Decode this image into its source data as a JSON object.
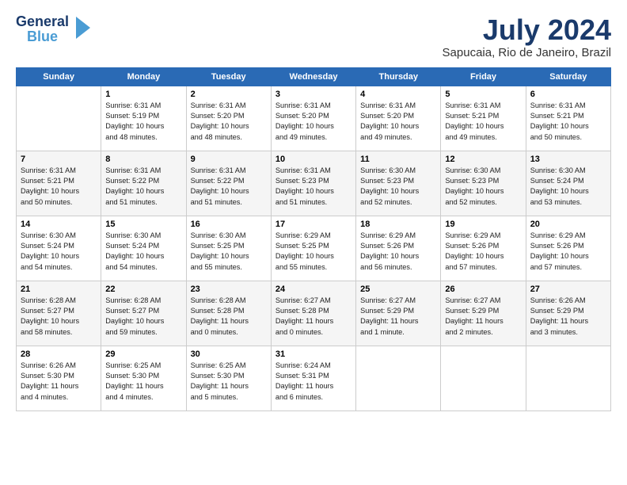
{
  "logo": {
    "line1": "General",
    "line2": "Blue",
    "icon": "▶"
  },
  "title": "July 2024",
  "subtitle": "Sapucaia, Rio de Janeiro, Brazil",
  "days_of_week": [
    "Sunday",
    "Monday",
    "Tuesday",
    "Wednesday",
    "Thursday",
    "Friday",
    "Saturday"
  ],
  "weeks": [
    [
      {
        "num": "",
        "info": ""
      },
      {
        "num": "1",
        "info": "Sunrise: 6:31 AM\nSunset: 5:19 PM\nDaylight: 10 hours\nand 48 minutes."
      },
      {
        "num": "2",
        "info": "Sunrise: 6:31 AM\nSunset: 5:20 PM\nDaylight: 10 hours\nand 48 minutes."
      },
      {
        "num": "3",
        "info": "Sunrise: 6:31 AM\nSunset: 5:20 PM\nDaylight: 10 hours\nand 49 minutes."
      },
      {
        "num": "4",
        "info": "Sunrise: 6:31 AM\nSunset: 5:20 PM\nDaylight: 10 hours\nand 49 minutes."
      },
      {
        "num": "5",
        "info": "Sunrise: 6:31 AM\nSunset: 5:21 PM\nDaylight: 10 hours\nand 49 minutes."
      },
      {
        "num": "6",
        "info": "Sunrise: 6:31 AM\nSunset: 5:21 PM\nDaylight: 10 hours\nand 50 minutes."
      }
    ],
    [
      {
        "num": "7",
        "info": "Sunrise: 6:31 AM\nSunset: 5:21 PM\nDaylight: 10 hours\nand 50 minutes."
      },
      {
        "num": "8",
        "info": "Sunrise: 6:31 AM\nSunset: 5:22 PM\nDaylight: 10 hours\nand 51 minutes."
      },
      {
        "num": "9",
        "info": "Sunrise: 6:31 AM\nSunset: 5:22 PM\nDaylight: 10 hours\nand 51 minutes."
      },
      {
        "num": "10",
        "info": "Sunrise: 6:31 AM\nSunset: 5:23 PM\nDaylight: 10 hours\nand 51 minutes."
      },
      {
        "num": "11",
        "info": "Sunrise: 6:30 AM\nSunset: 5:23 PM\nDaylight: 10 hours\nand 52 minutes."
      },
      {
        "num": "12",
        "info": "Sunrise: 6:30 AM\nSunset: 5:23 PM\nDaylight: 10 hours\nand 52 minutes."
      },
      {
        "num": "13",
        "info": "Sunrise: 6:30 AM\nSunset: 5:24 PM\nDaylight: 10 hours\nand 53 minutes."
      }
    ],
    [
      {
        "num": "14",
        "info": "Sunrise: 6:30 AM\nSunset: 5:24 PM\nDaylight: 10 hours\nand 54 minutes."
      },
      {
        "num": "15",
        "info": "Sunrise: 6:30 AM\nSunset: 5:24 PM\nDaylight: 10 hours\nand 54 minutes."
      },
      {
        "num": "16",
        "info": "Sunrise: 6:30 AM\nSunset: 5:25 PM\nDaylight: 10 hours\nand 55 minutes."
      },
      {
        "num": "17",
        "info": "Sunrise: 6:29 AM\nSunset: 5:25 PM\nDaylight: 10 hours\nand 55 minutes."
      },
      {
        "num": "18",
        "info": "Sunrise: 6:29 AM\nSunset: 5:26 PM\nDaylight: 10 hours\nand 56 minutes."
      },
      {
        "num": "19",
        "info": "Sunrise: 6:29 AM\nSunset: 5:26 PM\nDaylight: 10 hours\nand 57 minutes."
      },
      {
        "num": "20",
        "info": "Sunrise: 6:29 AM\nSunset: 5:26 PM\nDaylight: 10 hours\nand 57 minutes."
      }
    ],
    [
      {
        "num": "21",
        "info": "Sunrise: 6:28 AM\nSunset: 5:27 PM\nDaylight: 10 hours\nand 58 minutes."
      },
      {
        "num": "22",
        "info": "Sunrise: 6:28 AM\nSunset: 5:27 PM\nDaylight: 10 hours\nand 59 minutes."
      },
      {
        "num": "23",
        "info": "Sunrise: 6:28 AM\nSunset: 5:28 PM\nDaylight: 11 hours\nand 0 minutes."
      },
      {
        "num": "24",
        "info": "Sunrise: 6:27 AM\nSunset: 5:28 PM\nDaylight: 11 hours\nand 0 minutes."
      },
      {
        "num": "25",
        "info": "Sunrise: 6:27 AM\nSunset: 5:29 PM\nDaylight: 11 hours\nand 1 minute."
      },
      {
        "num": "26",
        "info": "Sunrise: 6:27 AM\nSunset: 5:29 PM\nDaylight: 11 hours\nand 2 minutes."
      },
      {
        "num": "27",
        "info": "Sunrise: 6:26 AM\nSunset: 5:29 PM\nDaylight: 11 hours\nand 3 minutes."
      }
    ],
    [
      {
        "num": "28",
        "info": "Sunrise: 6:26 AM\nSunset: 5:30 PM\nDaylight: 11 hours\nand 4 minutes."
      },
      {
        "num": "29",
        "info": "Sunrise: 6:25 AM\nSunset: 5:30 PM\nDaylight: 11 hours\nand 4 minutes."
      },
      {
        "num": "30",
        "info": "Sunrise: 6:25 AM\nSunset: 5:30 PM\nDaylight: 11 hours\nand 5 minutes."
      },
      {
        "num": "31",
        "info": "Sunrise: 6:24 AM\nSunset: 5:31 PM\nDaylight: 11 hours\nand 6 minutes."
      },
      {
        "num": "",
        "info": ""
      },
      {
        "num": "",
        "info": ""
      },
      {
        "num": "",
        "info": ""
      }
    ]
  ]
}
